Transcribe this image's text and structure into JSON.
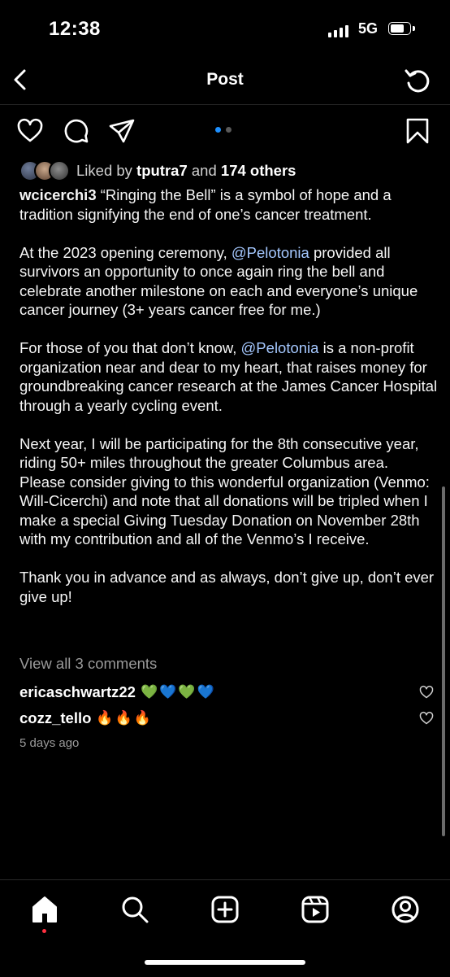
{
  "status": {
    "time": "12:38",
    "network": "5G"
  },
  "nav": {
    "title": "Post"
  },
  "post": {
    "likes": {
      "prefix": "Liked by ",
      "user": "tputra7",
      "and": " and ",
      "others": "174 others"
    },
    "author": "wcicerchi3",
    "caption_1": " “Ringing the Bell” is a symbol of hope and a tradition signifying the end of one’s cancer treatment.",
    "p2_a": "At the 2023 opening ceremony, ",
    "mention": "@Pelotonia",
    "p2_b": " provided all survivors an opportunity to once again ring the bell and celebrate another milestone on each and everyone’s unique cancer journey (3+ years cancer free for me.)",
    "p3_a": "For those of you that don’t know, ",
    "p3_b": " is a non-profit organization near and dear to my heart, that raises money for groundbreaking cancer research at the James Cancer Hospital through a yearly cycling event.",
    "p4": "Next year, I will be participating for the 8th consecutive year, riding 50+ miles throughout the greater Columbus area. Please consider giving to this wonderful organization (Venmo:  Will-Cicerchi) and note that all donations will be tripled when I make a special Giving Tuesday Donation on November 28th with my contribution and all of the Venmo’s I receive.",
    "p5": "Thank you in advance and as always, don’t give up, don’t ever give up!",
    "view_all": "View all 3 comments",
    "comments": [
      {
        "user": "ericaschwartz22",
        "text": "💚💙💚💙"
      },
      {
        "user": "cozz_tello",
        "text": "🔥🔥🔥"
      }
    ],
    "time_ago": "5 days ago",
    "carousel": {
      "count": 2,
      "active": 1
    }
  },
  "colors": {
    "background": "#000000",
    "mention": "#a5c8ff",
    "carousel_active": "#1e90ff",
    "notification_dot": "#ff3040"
  },
  "icons": {
    "actions": [
      "heart-icon",
      "comment-icon",
      "share-icon",
      "bookmark-icon"
    ],
    "tabs": [
      "home-icon",
      "search-icon",
      "create-icon",
      "reels-icon",
      "profile-icon"
    ]
  }
}
